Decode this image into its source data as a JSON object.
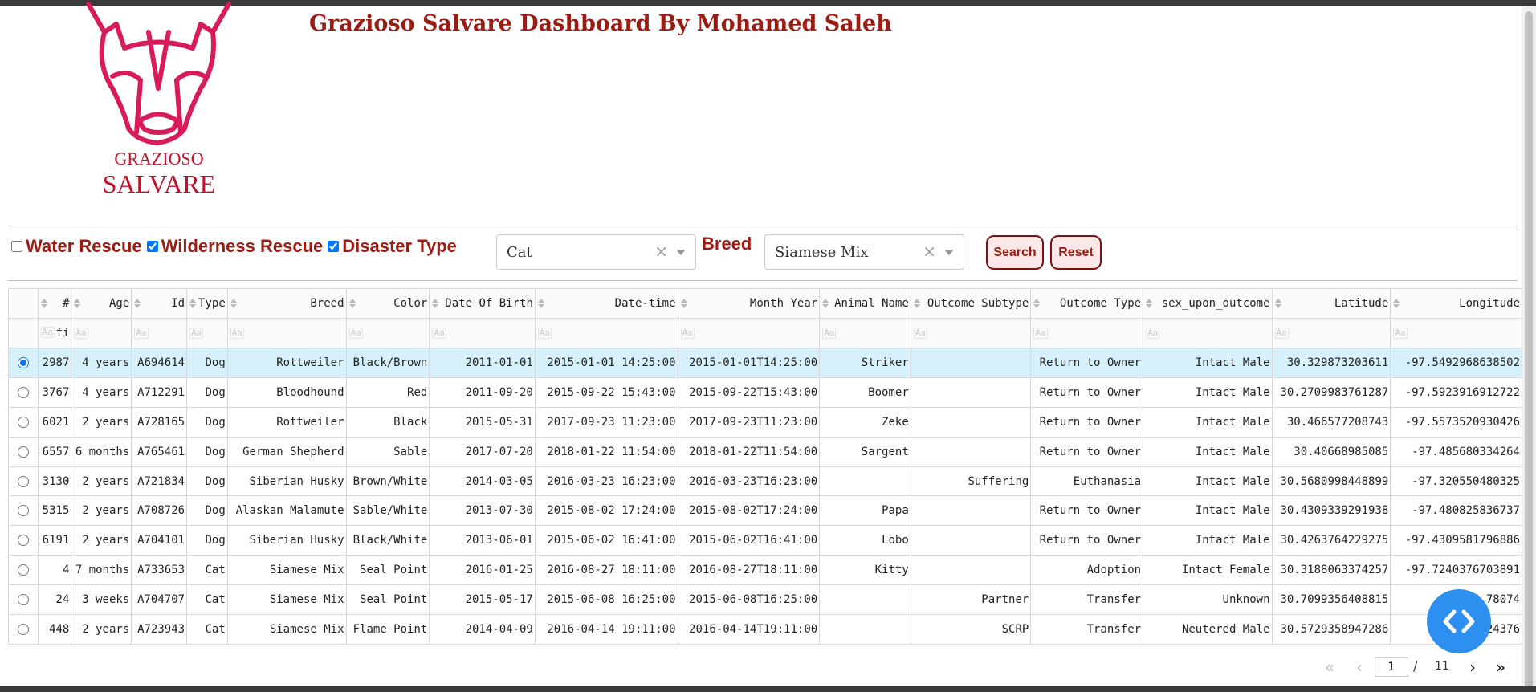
{
  "header": {
    "title": "Grazioso Salvare Dashboard By Mohamed Saleh",
    "logo_top": "GRAZIOSO",
    "logo_bottom": "SALVARE"
  },
  "filters": {
    "options": [
      {
        "label": "Water Rescue",
        "checked": false
      },
      {
        "label": "Wilderness Rescue",
        "checked": true
      },
      {
        "label": "Disaster Type",
        "checked": true
      }
    ],
    "type_dropdown": {
      "value": "Cat",
      "clear": "×"
    },
    "breed_label": "Breed",
    "breed_dropdown": {
      "value": "Siamese Mix",
      "clear": "×"
    },
    "search_label": "Search",
    "reset_label": "Reset"
  },
  "table": {
    "columns": [
      "#",
      "Age",
      "Id",
      "Type",
      "Breed",
      "Color",
      "Date Of Birth",
      "Date-time",
      "Month Year",
      "Animal Name",
      "Outcome Subtype",
      "Outcome Type",
      "sex_upon_outcome",
      "Latitude",
      "Longitude"
    ],
    "filter_placeholder": "Aa",
    "first_filter_value": "fi",
    "selected_row": 0,
    "rows": [
      [
        "2987",
        "4 years",
        "A694614",
        "Dog",
        "Rottweiler",
        "Black/Brown",
        "2011-01-01",
        "2015-01-01 14:25:00",
        "2015-01-01T14:25:00",
        "Striker",
        "",
        "Return to Owner",
        "Intact Male",
        "30.329873203611",
        "-97.5492968638502"
      ],
      [
        "3767",
        "4 years",
        "A712291",
        "Dog",
        "Bloodhound",
        "Red",
        "2011-09-20",
        "2015-09-22 15:43:00",
        "2015-09-22T15:43:00",
        "Boomer",
        "",
        "Return to Owner",
        "Intact Male",
        "30.2709983761287",
        "-97.5923916912722"
      ],
      [
        "6021",
        "2 years",
        "A728165",
        "Dog",
        "Rottweiler",
        "Black",
        "2015-05-31",
        "2017-09-23 11:23:00",
        "2017-09-23T11:23:00",
        "Zeke",
        "",
        "Return to Owner",
        "Intact Male",
        "30.466577208743",
        "-97.5573520930426"
      ],
      [
        "6557",
        "6 months",
        "A765461",
        "Dog",
        "German Shepherd",
        "Sable",
        "2017-07-20",
        "2018-01-22 11:54:00",
        "2018-01-22T11:54:00",
        "Sargent",
        "",
        "Return to Owner",
        "Intact Male",
        "30.40668985085",
        "-97.485680334264"
      ],
      [
        "3130",
        "2 years",
        "A721834",
        "Dog",
        "Siberian Husky",
        "Brown/White",
        "2014-03-05",
        "2016-03-23 16:23:00",
        "2016-03-23T16:23:00",
        "",
        "Suffering",
        "Euthanasia",
        "Intact Male",
        "30.5680998448899",
        "-97.320550480325"
      ],
      [
        "5315",
        "2 years",
        "A708726",
        "Dog",
        "Alaskan Malamute",
        "Sable/White",
        "2013-07-30",
        "2015-08-02 17:24:00",
        "2015-08-02T17:24:00",
        "Papa",
        "",
        "Return to Owner",
        "Intact Male",
        "30.4309339291938",
        "-97.480825836737"
      ],
      [
        "6191",
        "2 years",
        "A704101",
        "Dog",
        "Siberian Husky",
        "Black/White",
        "2013-06-01",
        "2015-06-02 16:41:00",
        "2015-06-02T16:41:00",
        "Lobo",
        "",
        "Return to Owner",
        "Intact Male",
        "30.4263764229275",
        "-97.4309581796886"
      ],
      [
        "4",
        "7 months",
        "A733653",
        "Cat",
        "Siamese Mix",
        "Seal Point",
        "2016-01-25",
        "2016-08-27 18:11:00",
        "2016-08-27T18:11:00",
        "Kitty",
        "",
        "Adoption",
        "Intact Female",
        "30.3188063374257",
        "-97.7240376703891"
      ],
      [
        "24",
        "3 weeks",
        "A704707",
        "Cat",
        "Siamese Mix",
        "Seal Point",
        "2015-05-17",
        "2015-06-08 16:25:00",
        "2015-06-08T16:25:00",
        "",
        "Partner",
        "Transfer",
        "Unknown",
        "30.7099356408815",
        "-97.6         78074"
      ],
      [
        "448",
        "2 years",
        "A723943",
        "Cat",
        "Siamese Mix",
        "Flame Point",
        "2014-04-09",
        "2016-04-14 19:11:00",
        "2016-04-14T19:11:00",
        "",
        "SCRP",
        "Transfer",
        "Neutered Male",
        "30.5729358947286",
        "-97.4         24376"
      ]
    ]
  },
  "pager": {
    "current": "1",
    "separator": "/",
    "total": "11"
  },
  "colors": {
    "brand": "#9b1c13",
    "logo": "#d81b5a",
    "selected_row": "#d6f1fb",
    "fab": "#2d8ff0"
  }
}
